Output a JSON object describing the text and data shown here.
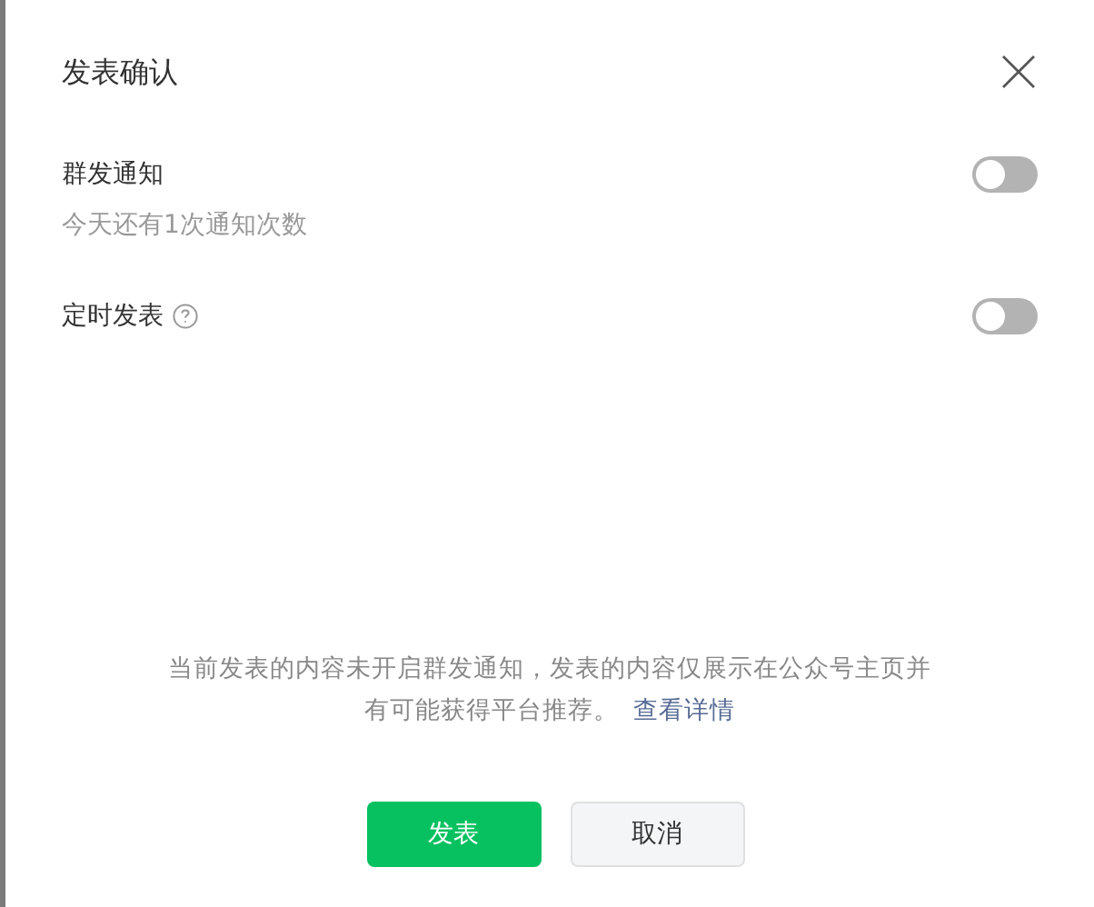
{
  "dialog": {
    "title": "发表确认"
  },
  "settings": [
    {
      "label": "群发通知",
      "hint": "今天还有1次通知次数",
      "help": false,
      "on": false
    },
    {
      "label": "定时发表",
      "help": true,
      "on": false
    }
  ],
  "notice": {
    "text": "当前发表的内容未开启群发通知，发表的内容仅展示在公众号主页并有可能获得平台推荐。",
    "link": "查看详情"
  },
  "buttons": [
    {
      "label": "发表",
      "kind": "primary"
    },
    {
      "label": "取消",
      "kind": "secondary"
    }
  ]
}
